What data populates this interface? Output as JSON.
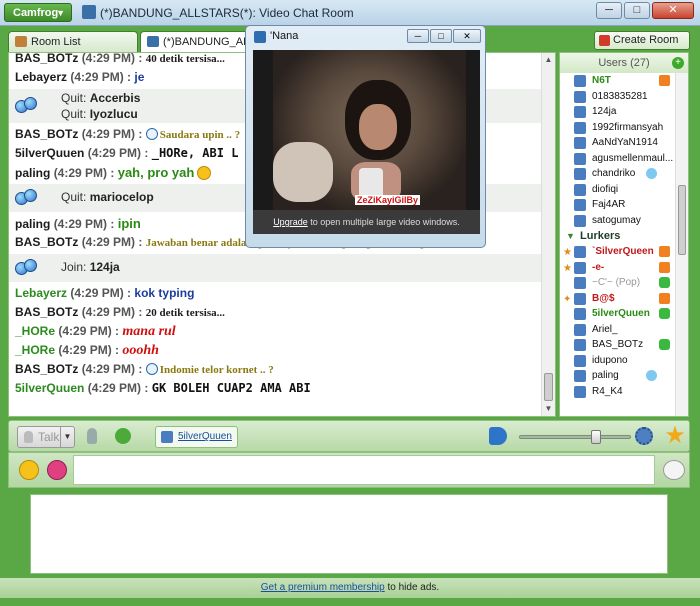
{
  "window": {
    "app_button": "Camfrog",
    "title": "(*)BANDUNG_ALLSTARS(*): Video Chat Room",
    "minimize": "─",
    "maximize": "□",
    "close": "✕"
  },
  "tabs": [
    {
      "label": "Room List"
    },
    {
      "label": "(*)BANDUNG_ALLS..."
    }
  ],
  "create_room": "Create Room",
  "chat": {
    "lines": [
      {
        "type": "msg",
        "nick": "BAS_BOTz",
        "time": "(4:29 PM) :",
        "text": "40 detik tersisa...",
        "style": "black-serif"
      },
      {
        "type": "msg",
        "nick": "Lebayerz",
        "time": "(4:29 PM) :",
        "text": "je",
        "style": "blue"
      },
      {
        "type": "sys2",
        "label1": "Quit:",
        "val1": "Accerbis",
        "label2": "Quit:",
        "val2": "Iyozlucu"
      },
      {
        "type": "msg",
        "nick": "BAS_BOTz",
        "time": "(4:29 PM) :",
        "text": "Saudara upin .. ?",
        "style": "olive",
        "clock": true
      },
      {
        "type": "msg",
        "nick": "5ilverQuuen",
        "time": "(4:29 PM) :",
        "text": "_HORe, ABI L",
        "style": "mono"
      },
      {
        "type": "msg",
        "nick": "paling",
        "time": "(4:29 PM) :",
        "text": "yah, pro yah",
        "style": "green",
        "smile": true
      },
      {
        "type": "sys1",
        "label1": "Quit:",
        "val1": "mariocelop"
      },
      {
        "type": "msg",
        "nick": "paling",
        "time": "(4:29 PM) :",
        "text": "ipin",
        "style": "green"
      },
      {
        "type": "msg",
        "nick": "BAS_BOTz",
        "time": "(4:29 PM) :",
        "text": "Jawaban benar adalah ipin, dijawab oleh paling, total 837 poin",
        "style": "olive"
      },
      {
        "type": "sys1",
        "label1": "Join:",
        "val1": "124ja"
      },
      {
        "type": "msg",
        "nick": "Lebayerz",
        "time": "(4:29 PM) :",
        "text": "kok typing",
        "style": "blue",
        "nickColor": "green"
      },
      {
        "type": "msg",
        "nick": "BAS_BOTz",
        "time": "(4:29 PM) :",
        "text": "20 detik tersisa...",
        "style": "black-serif"
      },
      {
        "type": "msg",
        "nick": "_HORe",
        "time": "(4:29 PM) :",
        "text": "mana rul",
        "style": "red",
        "nickColor": "green"
      },
      {
        "type": "msg",
        "nick": "_HORe",
        "time": "(4:29 PM) :",
        "text": "ooohh",
        "style": "red",
        "nickColor": "green"
      },
      {
        "type": "msg",
        "nick": "BAS_BOTz",
        "time": "(4:29 PM) :",
        "text": "Indomie telor kornet .. ?",
        "style": "olive",
        "clock": true
      },
      {
        "type": "msg",
        "nick": "5ilverQuuen",
        "time": "(4:29 PM) :",
        "text": "GK BOLEH CUAP2 AMA ABI",
        "style": "mono",
        "nickColor": "green"
      }
    ]
  },
  "users": {
    "header": "Users (27)",
    "add": "+",
    "list": [
      {
        "name": "N6T",
        "color": "green",
        "tag": "home"
      },
      {
        "name": "0183835281"
      },
      {
        "name": "124ja"
      },
      {
        "name": "1992firmansyah"
      },
      {
        "name": "AaNdYaN1914"
      },
      {
        "name": "agusmellenmaul..."
      },
      {
        "name": "chandriko",
        "tag": "face"
      },
      {
        "name": "diofiqi"
      },
      {
        "name": "Faj4AR"
      },
      {
        "name": "satogumay"
      }
    ],
    "lurkers_label": "Lurkers",
    "lurkers": [
      {
        "name": "`SilverQueen",
        "color": "red",
        "tag": "home",
        "pre": "★"
      },
      {
        "name": "-e-",
        "color": "red",
        "tag": "home",
        "pre": "★"
      },
      {
        "name": "~C'~ (Pop)",
        "color": "gray",
        "tag": "s"
      },
      {
        "name": "B@$",
        "color": "red",
        "tag": "home",
        "pre": "✦"
      },
      {
        "name": "5ilverQuuen",
        "color": "green",
        "tag": "s"
      },
      {
        "name": "Ariel_"
      },
      {
        "name": "BAS_BOTz",
        "tag": "s"
      },
      {
        "name": "idupono"
      },
      {
        "name": "paling",
        "tag": "face"
      },
      {
        "name": "R4_K4"
      }
    ]
  },
  "controls": {
    "talk": "Talk",
    "speaker_name": "5ilverQuuen",
    "volume_fraction": 0.7
  },
  "video": {
    "title": "'Nana",
    "overlay_name": "ZeZiKayiGilBy",
    "caption_link": "Upgrade",
    "caption_rest": " to open multiple large video windows."
  },
  "footer": {
    "link": "Get a premium membership",
    "rest": " to hide ads."
  }
}
